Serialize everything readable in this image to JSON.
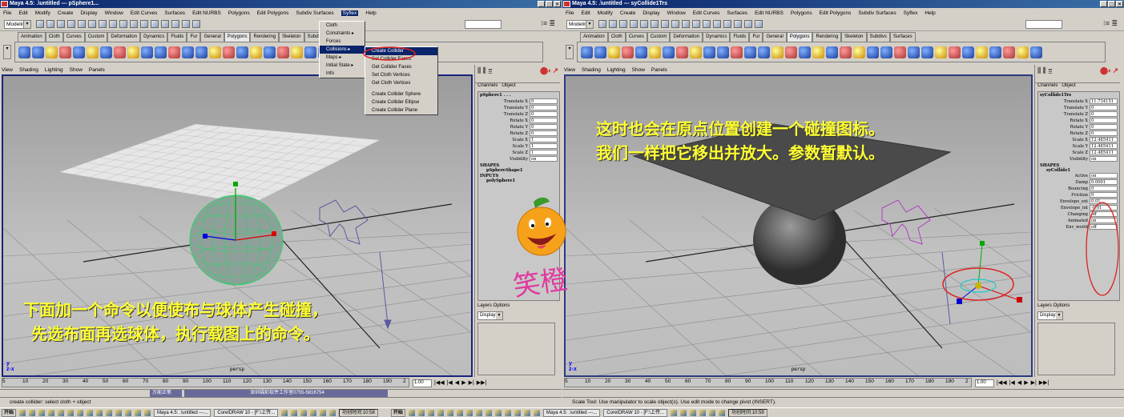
{
  "left": {
    "title": "Maya 4.5: .\\untitled  ---  pSphere1...",
    "menus": [
      "File",
      "Edit",
      "Modify",
      "Create",
      "Display",
      "Window",
      "Edit Curves",
      "Surfaces",
      "Edit NURBS",
      "Polygons",
      "Edit Polygons",
      "Subdiv Surfaces",
      "Syflex",
      "Help"
    ],
    "mode": "Modeling",
    "sel_field": "sel▾",
    "shelf_tabs": [
      "Animation",
      "Cloth",
      "Curves",
      "Custom",
      "Deformation",
      "Dynamics",
      "Fluids",
      "Fur",
      "General",
      "Polygons",
      "Rendering",
      "Skeleton",
      "Subdivs",
      "Surfaces"
    ],
    "panel_menu": [
      "View",
      "Shading",
      "Lighting",
      "Show",
      "Panels"
    ],
    "syflex_menu": [
      "Cloth",
      "Constraints ▸",
      "Forces",
      "Collisions ▸",
      "Maps ▸",
      "Initial State ▸",
      "Info"
    ],
    "collisions_submenu": [
      "Create Collider",
      "Set Collider Faces",
      "Get Collider Faces",
      "Set Cloth Vertices",
      "Get Cloth Vertices",
      "",
      "Create Collider Sphere",
      "Create Collider Ellipse",
      "Create Collider Plane"
    ],
    "channel_tabs": [
      "Channels",
      "Object"
    ],
    "node": "pSphere1 . . .",
    "channels": [
      {
        "label": "Translate X",
        "value": "0"
      },
      {
        "label": "Translate Y",
        "value": "0"
      },
      {
        "label": "Translate Z",
        "value": "0"
      },
      {
        "label": "Rotate X",
        "value": "0"
      },
      {
        "label": "Rotate Y",
        "value": "0"
      },
      {
        "label": "Rotate Z",
        "value": "0"
      },
      {
        "label": "Scale X",
        "value": "1"
      },
      {
        "label": "Scale Y",
        "value": "1"
      },
      {
        "label": "Scale Z",
        "value": "1"
      },
      {
        "label": "Visibility",
        "value": "on"
      }
    ],
    "shapes_label": "SHAPES",
    "shape": "pSphereShape1",
    "inputs_label": "INPUTS",
    "input": "polySphere1",
    "layer_tabs": "Layers  Options",
    "layer_display": "Display",
    "persp": "persp",
    "overlay_line1": "下面加一个命令以便使布与球体产生碰撞，",
    "overlay_line2": "先选布面再选球体，执行载图上的命令。",
    "timeline": [
      "5",
      "10",
      "20",
      "30",
      "40",
      "50",
      "60",
      "70",
      "80",
      "90",
      "100",
      "110",
      "120",
      "130",
      "140",
      "150",
      "160",
      "170",
      "180",
      "190",
      "2"
    ],
    "frame": "1.00",
    "range_left": "万能正笔",
    "range_right": "深圳福彩软件工作室0755-5816754",
    "help": "create collider: select cloth + object"
  },
  "right": {
    "title": "Maya 4.5: .\\untitled  ---  syCollide1Trs",
    "mode": "Modeling",
    "sel_field": "sel▾",
    "shelf_tabs": [
      "Animation",
      "Cloth",
      "Curves",
      "Custom",
      "Deformation",
      "Dynamics",
      "Fluids",
      "Fur",
      "General",
      "Polygons",
      "Rendering",
      "Skeleton",
      "Subdivs",
      "Surfaces"
    ],
    "node": "syCollide1Trs",
    "channels": [
      {
        "label": "Translate X",
        "value": "11.734151"
      },
      {
        "label": "Translate Y",
        "value": "0"
      },
      {
        "label": "Translate Z",
        "value": "0"
      },
      {
        "label": "Rotate X",
        "value": "0"
      },
      {
        "label": "Rotate Y",
        "value": "0"
      },
      {
        "label": "Rotate Z",
        "value": "0"
      },
      {
        "label": "Scale X",
        "value": "12.485411"
      },
      {
        "label": "Scale Y",
        "value": "12.485411"
      },
      {
        "label": "Scale Z",
        "value": "12.485411"
      },
      {
        "label": "Visibility",
        "value": "on"
      }
    ],
    "shapes_label": "SHAPES",
    "shape": "syCollide1",
    "shape_channels": [
      {
        "label": "Active",
        "value": "on"
      },
      {
        "label": "Damp",
        "value": "0.0001"
      },
      {
        "label": "Bouncing",
        "value": "0"
      },
      {
        "label": "Friction",
        "value": "0"
      },
      {
        "label": "Envelope_ext",
        "value": "0.01"
      },
      {
        "label": "Envelope_int",
        "value": "-0.01"
      },
      {
        "label": "Changing",
        "value": "off"
      },
      {
        "label": "Animated",
        "value": "on"
      },
      {
        "label": "Env_world",
        "value": "off"
      }
    ],
    "overlay_line1": "这时也会在原点位置创建一个碰撞图标。",
    "overlay_line2": "我们一样把它移出并放大。参数暂默认。",
    "help": "Scale Tool: Use manipulator to scale object(s). Use edit mode to change pivot (INSERT)."
  },
  "logo_text": "笑橙",
  "taskbar": {
    "start": "开始",
    "left_task1": "Maya 4.5: .\\untitled ---...",
    "left_task2": "CorelDRAW 10 - [F:\\上传...",
    "left_clock": "功创时间:10:58",
    "right_task1": "Maya 4.5: .\\untitled ---...",
    "right_task2": "CorelDRAW 10 - [F:\\上传...",
    "right_clock": "功创时间:10:59"
  }
}
